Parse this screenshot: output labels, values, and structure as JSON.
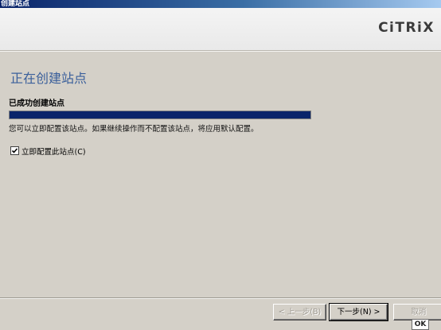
{
  "window": {
    "title": "创建站点"
  },
  "header": {
    "logo_text": "CiTRiX"
  },
  "page": {
    "title": "正在创建站点",
    "status_label": "已成功创建站点",
    "progress_percent": 100,
    "info_text": "您可以立即配置该站点。如果继续操作而不配置该站点，将应用默认配置。",
    "checkbox": {
      "label": "立即配置此站点(C)",
      "checked": true
    }
  },
  "buttons": {
    "back": "< 上一步(B)",
    "next": "下一步(N) >",
    "cancel": "取消"
  },
  "tooltip": {
    "text": "OK"
  },
  "colors": {
    "title_blue": "#3a5f9b",
    "progress_fill": "#0a246a",
    "dialog_bg": "#d4d0c8"
  }
}
